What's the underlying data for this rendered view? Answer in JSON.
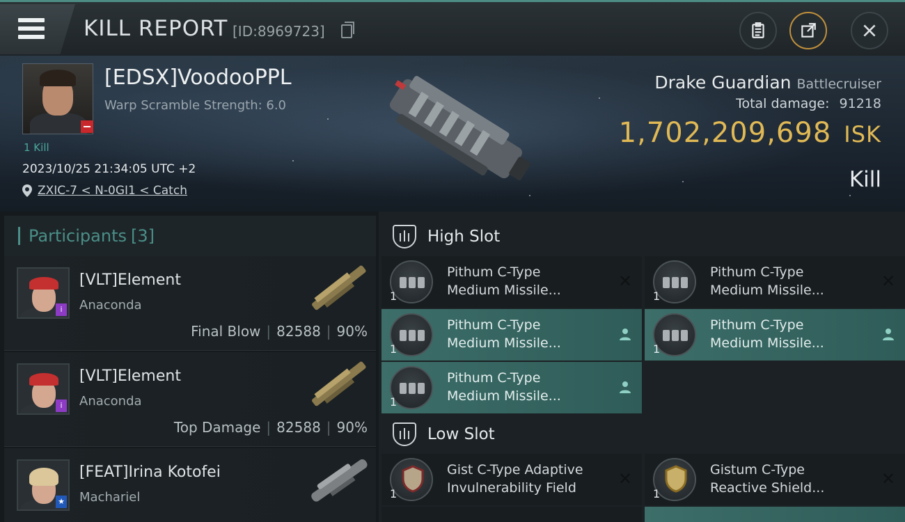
{
  "header": {
    "title": "KILL REPORT",
    "report_id": "[ID:8969723]",
    "icons": [
      "menu-icon",
      "clipboard-icon",
      "share-icon",
      "close-icon"
    ]
  },
  "victim": {
    "name": "[EDSX]VoodooPPL",
    "warp_scramble": "Warp Scramble Strength: 6.0",
    "kill_count": "1 Kill",
    "datetime": "2023/10/25 21:34:05 UTC +2",
    "location": "ZXIC-7 < N-0GI1 < Catch",
    "ship_name": "Drake Guardian",
    "ship_class": "Battlecruiser",
    "total_damage_label": "Total damage:",
    "total_damage": "91218",
    "isk_value": "1,702,209,698",
    "isk_unit": "ISK",
    "kill_type": "Kill"
  },
  "participants": {
    "label": "Participants",
    "count": "[3]",
    "items": [
      {
        "name": "[VLT]Element",
        "ship": "Anaconda",
        "role": "Final Blow",
        "damage": "82588",
        "percent": "90%"
      },
      {
        "name": "[VLT]Element",
        "ship": "Anaconda",
        "role": "Top Damage",
        "damage": "82588",
        "percent": "90%"
      },
      {
        "name": "[FEAT]Irina Kotofei",
        "ship": "Machariel",
        "role": "",
        "damage": "",
        "percent": ""
      }
    ]
  },
  "slots": {
    "high_label": "High Slot",
    "low_label": "Low Slot",
    "high": [
      {
        "line1": "Pithum C-Type",
        "line2": "Medium Missile...",
        "qty": "1",
        "state": "destroyed"
      },
      {
        "line1": "Pithum C-Type",
        "line2": "Medium Missile...",
        "qty": "1",
        "state": "destroyed"
      },
      {
        "line1": "Pithum C-Type",
        "line2": "Medium Missile...",
        "qty": "1",
        "state": "dropped"
      },
      {
        "line1": "Pithum C-Type",
        "line2": "Medium Missile...",
        "qty": "1",
        "state": "dropped"
      },
      {
        "line1": "Pithum C-Type",
        "line2": "Medium Missile...",
        "qty": "1",
        "state": "dropped"
      }
    ],
    "low": [
      {
        "line1": "Gist C-Type Adaptive",
        "line2": "Invulnerability Field",
        "qty": "1",
        "state": "destroyed"
      },
      {
        "line1": "Gistum C-Type",
        "line2": "Reactive Shield...",
        "qty": "1",
        "state": "destroyed"
      }
    ]
  },
  "colors": {
    "accent_teal": "#4a8f88",
    "isk_gold": "#e0b955",
    "active_module": "#3d6e69"
  }
}
